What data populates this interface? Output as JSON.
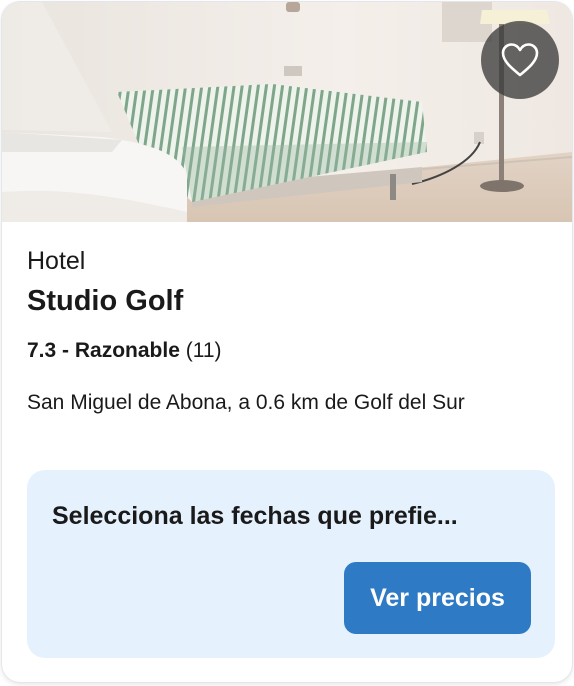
{
  "hotel": {
    "type": "Hotel",
    "name": "Studio Golf",
    "rating_score": "7.3 - Razonable",
    "rating_count": "(11)",
    "location": "San Miguel de Abona, a 0.6 km de Golf del Sur"
  },
  "favorite": {
    "icon": "heart-icon"
  },
  "pricing": {
    "message": "Selecciona las fechas que prefie...",
    "button_label": "Ver precios"
  },
  "colors": {
    "accent": "#2f7ac4",
    "price_box_bg": "#e5f2fd",
    "text": "#1a1a1a"
  }
}
